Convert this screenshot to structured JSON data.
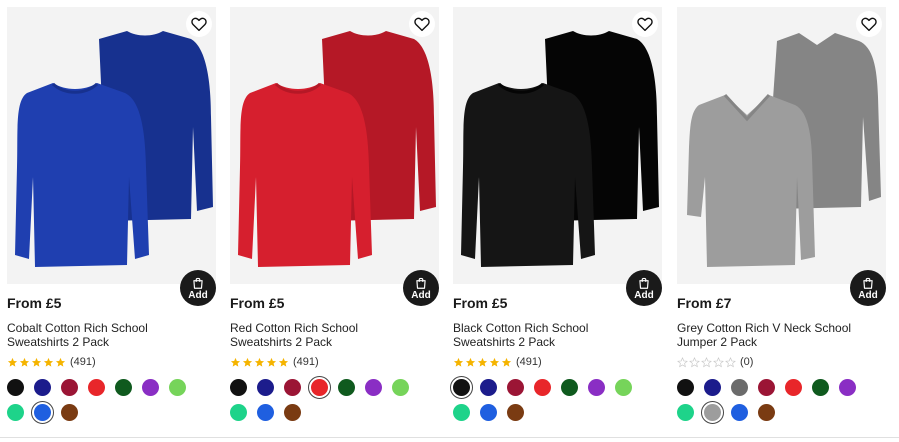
{
  "products": [
    {
      "price": "From £5",
      "title": "Cobalt Cotton Rich School Sweatshirts 2 Pack",
      "rating": 5,
      "review_count": "(491)",
      "garment": "crew",
      "garment_color": "#1f3fb0",
      "garment_shade": "#17318f",
      "selected_swatch": 8,
      "swatches": [
        "#111111",
        "#1c1c8c",
        "#9b1535",
        "#e8262a",
        "#0f5a1e",
        "#8a2ec4",
        "#76d45a",
        "#1ed38a",
        "#1f5fe0",
        "#7a3b12"
      ]
    },
    {
      "price": "From £5",
      "title": "Red Cotton Rich School Sweatshirts 2 Pack",
      "rating": 5,
      "review_count": "(491)",
      "garment": "crew",
      "garment_color": "#d61f2e",
      "garment_shade": "#b51826",
      "selected_swatch": 3,
      "swatches": [
        "#111111",
        "#1c1c8c",
        "#9b1535",
        "#e8262a",
        "#0f5a1e",
        "#8a2ec4",
        "#76d45a",
        "#1ed38a",
        "#1f5fe0",
        "#7a3b12"
      ]
    },
    {
      "price": "From £5",
      "title": "Black Cotton Rich School Sweatshirts 2 Pack",
      "rating": 5,
      "review_count": "(491)",
      "garment": "crew",
      "garment_color": "#151515",
      "garment_shade": "#050505",
      "selected_swatch": 0,
      "swatches": [
        "#111111",
        "#1c1c8c",
        "#9b1535",
        "#e8262a",
        "#0f5a1e",
        "#8a2ec4",
        "#76d45a",
        "#1ed38a",
        "#1f5fe0",
        "#7a3b12"
      ]
    },
    {
      "price": "From £7",
      "title": "Grey Cotton Rich V Neck School Jumper 2 Pack",
      "rating": 0,
      "review_count": "(0)",
      "garment": "vneck",
      "garment_color": "#9d9d9d",
      "garment_shade": "#858585",
      "selected_swatch": 8,
      "swatches": [
        "#111111",
        "#1c1c8c",
        "#6b6b6b",
        "#9b1535",
        "#e8262a",
        "#0f5a1e",
        "#8a2ec4",
        "#1ed38a",
        "#9d9d9d",
        "#1f5fe0",
        "#7a3b12"
      ]
    }
  ],
  "labels": {
    "add": "Add"
  },
  "icons": {
    "favourite": "heart-icon",
    "add": "shopping-bag-icon",
    "star": "star-icon"
  },
  "colors": {
    "star_filled": "#f5b400",
    "star_empty": "#c9c9c9",
    "add_bg": "#1a1a1a"
  }
}
